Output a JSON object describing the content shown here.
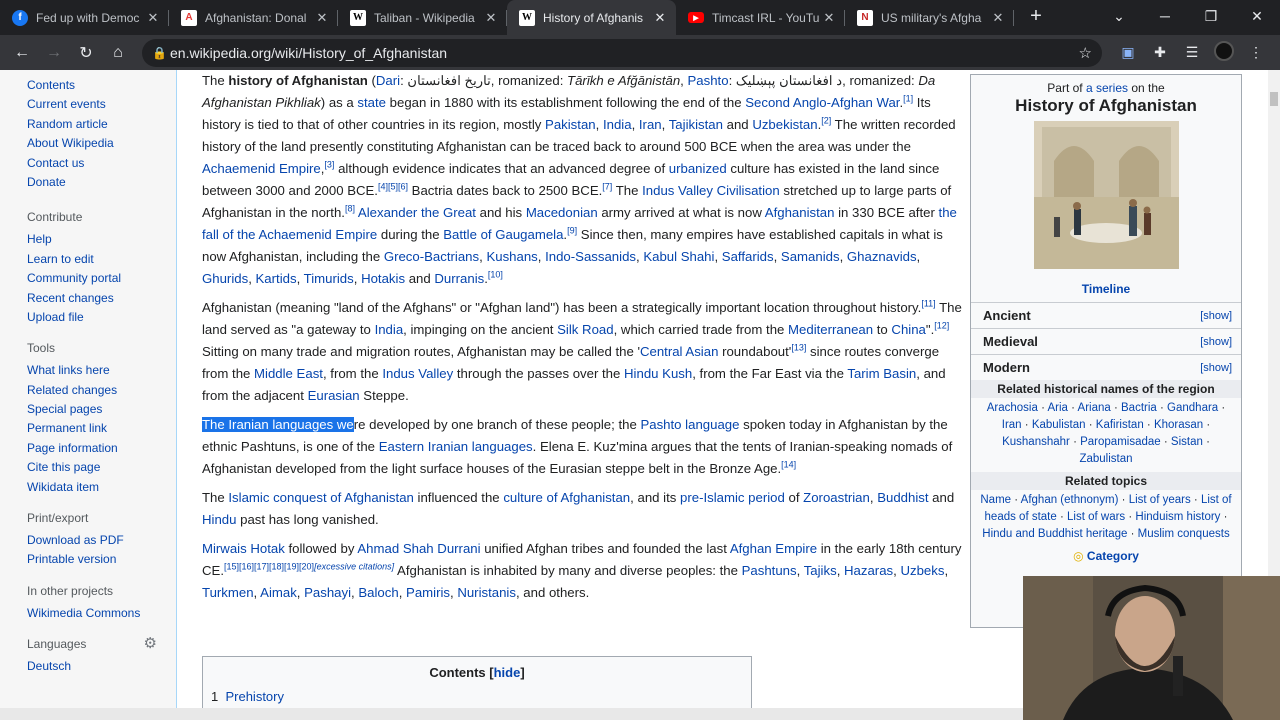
{
  "browser": {
    "tabs": [
      {
        "title": "Fed up with Democ",
        "icon": "facebook-icon",
        "color": "#1877f2"
      },
      {
        "title": "Afghanistan: Donal",
        "icon": "news-icon",
        "color": "#e53935"
      },
      {
        "title": "Taliban - Wikipedia",
        "icon": "wikipedia-icon",
        "color": "#ffffff"
      },
      {
        "title": "History of Afghanis",
        "icon": "wikipedia-icon",
        "color": "#ffffff"
      },
      {
        "title": "Timcast IRL - YouTu",
        "icon": "youtube-icon",
        "color": "#ff0000"
      },
      {
        "title": "US military's Afgha",
        "icon": "news-icon",
        "color": "#c62828"
      }
    ],
    "url": "en.wikipedia.org/wiki/History_of_Afghanistan"
  },
  "sidebar": {
    "nav": [
      "Contents",
      "Current events",
      "Random article",
      "About Wikipedia",
      "Contact us",
      "Donate"
    ],
    "contribute_heading": "Contribute",
    "contribute": [
      "Help",
      "Learn to edit",
      "Community portal",
      "Recent changes",
      "Upload file"
    ],
    "tools_heading": "Tools",
    "tools": [
      "What links here",
      "Related changes",
      "Special pages",
      "Permanent link",
      "Page information",
      "Cite this page",
      "Wikidata item"
    ],
    "print_heading": "Print/export",
    "print": [
      "Download as PDF",
      "Printable version"
    ],
    "projects_heading": "In other projects",
    "projects": [
      "Wikimedia Commons"
    ],
    "languages_heading": "Languages",
    "languages": [
      "Deutsch"
    ]
  },
  "infobox": {
    "part_of": "Part of",
    "series_link": "a series",
    "on_the": "on the",
    "title": "History of Afghanistan",
    "timeline": "Timeline",
    "rows": [
      {
        "label": "Ancient",
        "action": "[show]"
      },
      {
        "label": "Medieval",
        "action": "[show]"
      },
      {
        "label": "Modern",
        "action": "[show]"
      }
    ],
    "names_heading": "Related historical names of the region",
    "names": [
      "Arachosia",
      "Aria",
      "Ariana",
      "Bactria",
      "Gandhara",
      "Iran",
      "Kabulistan",
      "Kafiristan",
      "Khorasan",
      "Kushanshahr",
      "Paropamisadae",
      "Sistan",
      "Zabulistan"
    ],
    "topics_heading": "Related topics",
    "topics": [
      "Name",
      "Afghan (ethnonym)",
      "List of years",
      "List of heads of state",
      "List of wars",
      "Hinduism history",
      "Hindu and Buddhist heritage",
      "Muslim conquests"
    ],
    "category": "Category"
  },
  "toc": {
    "title": "Contents",
    "hide": "hide",
    "first_num": "1",
    "first_item": "Prehistory"
  }
}
